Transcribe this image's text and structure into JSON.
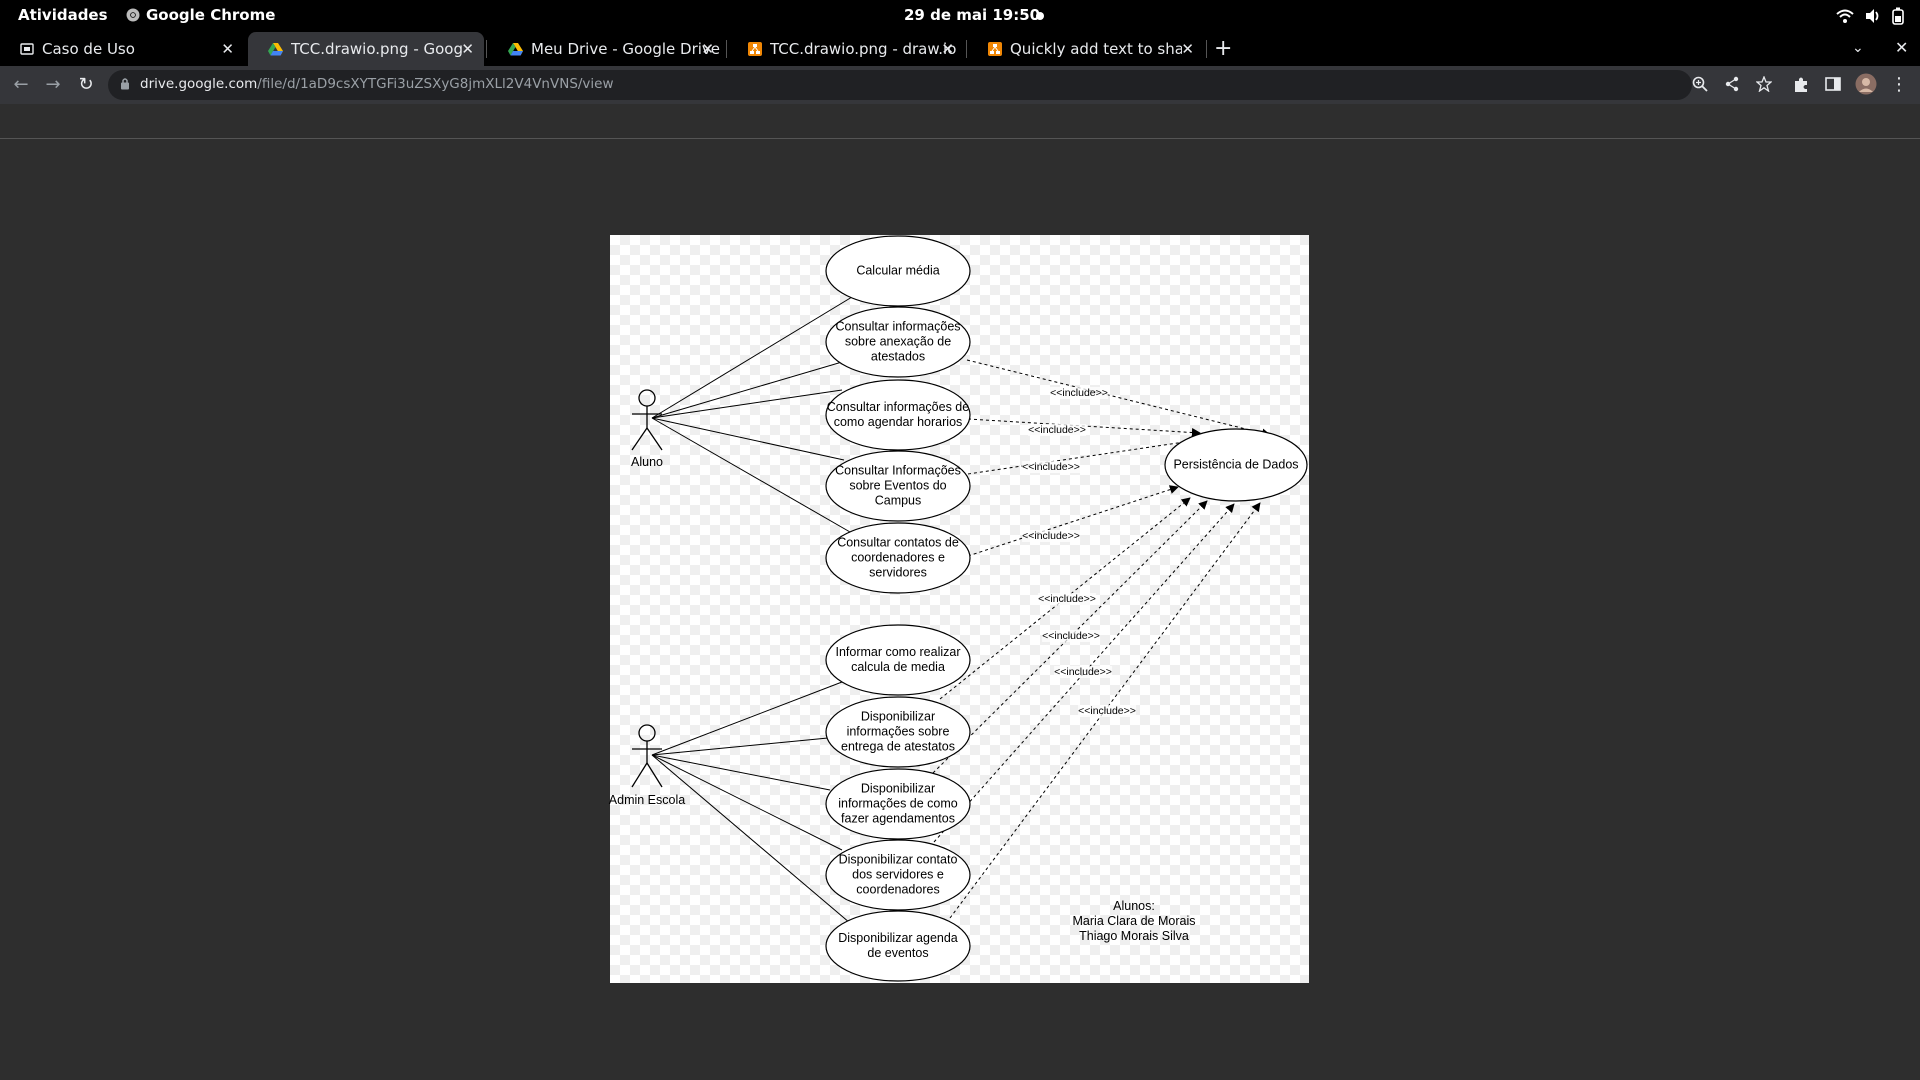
{
  "system_bar": {
    "activities": "Atividades",
    "app_name": "Google Chrome",
    "clock": "29 de mai  19:50"
  },
  "tabs": [
    {
      "title": "Caso de Uso",
      "icon": "slides-icon"
    },
    {
      "title": "TCC.drawio.png - Google Drive",
      "icon": "drive-icon",
      "active": true
    },
    {
      "title": "Meu Drive - Google Drive",
      "icon": "drive-icon"
    },
    {
      "title": "TCC.drawio.png - draw.io",
      "icon": "drawio-icon"
    },
    {
      "title": "Quickly add text to shapes",
      "icon": "drawio-icon"
    }
  ],
  "address_bar": {
    "host": "drive.google.com",
    "path": "/file/d/1aD9csXYTGFi3uZSXyG8jmXLl2V4VnVNS/view"
  },
  "diagram": {
    "actors": {
      "aluno": "Aluno",
      "admin": "Admin Escola"
    },
    "persistence": "Persistência de Dados",
    "include_label": "<<include>>",
    "use_cases": {
      "calc": [
        "Calcular média"
      ],
      "atestados": [
        "Consultar informações",
        "sobre anexação de",
        "atestados"
      ],
      "horarios": [
        "Consultar informações de",
        "como agendar horarios"
      ],
      "eventos": [
        "Consultar Informações",
        "sobre Eventos do",
        "Campus"
      ],
      "contatos": [
        "Consultar contatos de",
        "coordenadores e",
        "servidores"
      ],
      "informar": [
        "Informar como realizar",
        "calcula de media"
      ],
      "disp_atestados": [
        "Disponibilizar",
        "informações sobre",
        "entrega de atestatos"
      ],
      "disp_agend": [
        "Disponibilizar",
        "informações de como",
        "fazer agendamentos"
      ],
      "disp_contato": [
        "Disponibilizar contato",
        "dos servidores e",
        "coordenadores"
      ],
      "disp_agenda": [
        "Disponibilizar agenda",
        "de eventos"
      ]
    },
    "authors": [
      "Alunos:",
      "Maria Clara de Morais",
      "Thiago Morais Silva"
    ]
  },
  "colors": {
    "page_bg": "#2e2e2e",
    "tab_active": "#35363a",
    "omnibox": "#202124"
  }
}
